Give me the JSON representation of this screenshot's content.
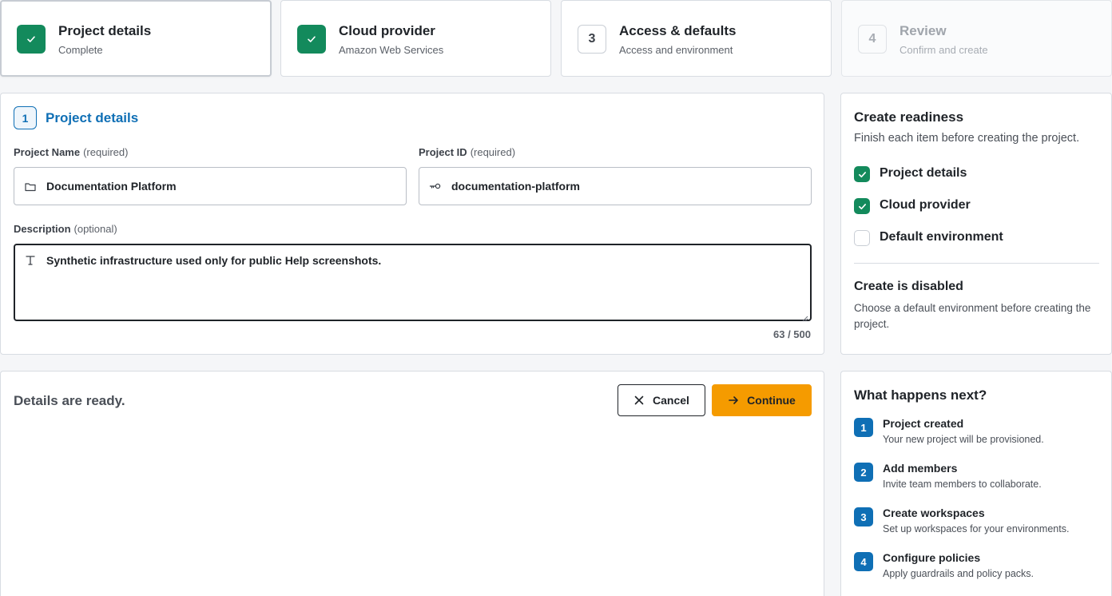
{
  "stepper": [
    {
      "title": "Project details",
      "subtitle": "Complete",
      "state": "complete"
    },
    {
      "title": "Cloud provider",
      "subtitle": "Amazon Web Services",
      "state": "complete"
    },
    {
      "number": "3",
      "title": "Access & defaults",
      "subtitle": "Access and environment",
      "state": "current"
    },
    {
      "number": "4",
      "title": "Review",
      "subtitle": "Confirm and create",
      "state": "upcoming"
    }
  ],
  "form": {
    "section_number": "1",
    "section_title": "Project details",
    "name_label": "Project Name",
    "name_req": "(required)",
    "name_value": "Documentation Platform",
    "name_icon": "folder-icon",
    "id_label": "Project ID",
    "id_req": "(required)",
    "id_value": "documentation-platform",
    "id_icon": "key-icon",
    "desc_label": "Description",
    "desc_req": "(optional)",
    "desc_value": "Synthetic infrastructure used only for public Help screenshots.",
    "desc_icon": "text-icon",
    "counter": "63 / 500"
  },
  "actions": {
    "status": "Details are ready.",
    "cancel_label": "Cancel",
    "continue_label": "Continue"
  },
  "readiness": {
    "title": "Create readiness",
    "subtitle": "Finish each item before creating the project.",
    "items": [
      {
        "label": "Project details",
        "done": true
      },
      {
        "label": "Cloud provider",
        "done": true
      },
      {
        "label": "Default environment",
        "done": false
      }
    ],
    "disabled_title": "Create is disabled",
    "disabled_text": "Choose a default environment before creating the project."
  },
  "next": {
    "title": "What happens next?",
    "items": [
      {
        "number": "1",
        "label": "Project created",
        "desc": "Your new project will be provisioned."
      },
      {
        "number": "2",
        "label": "Add members",
        "desc": "Invite team members to collaborate."
      },
      {
        "number": "3",
        "label": "Create workspaces",
        "desc": "Set up workspaces for your environments."
      },
      {
        "number": "4",
        "label": "Configure policies",
        "desc": "Apply guardrails and policy packs."
      }
    ]
  },
  "colors": {
    "success": "#138a5c",
    "accent": "#0f6fb5",
    "primary_button": "#f59b00"
  }
}
